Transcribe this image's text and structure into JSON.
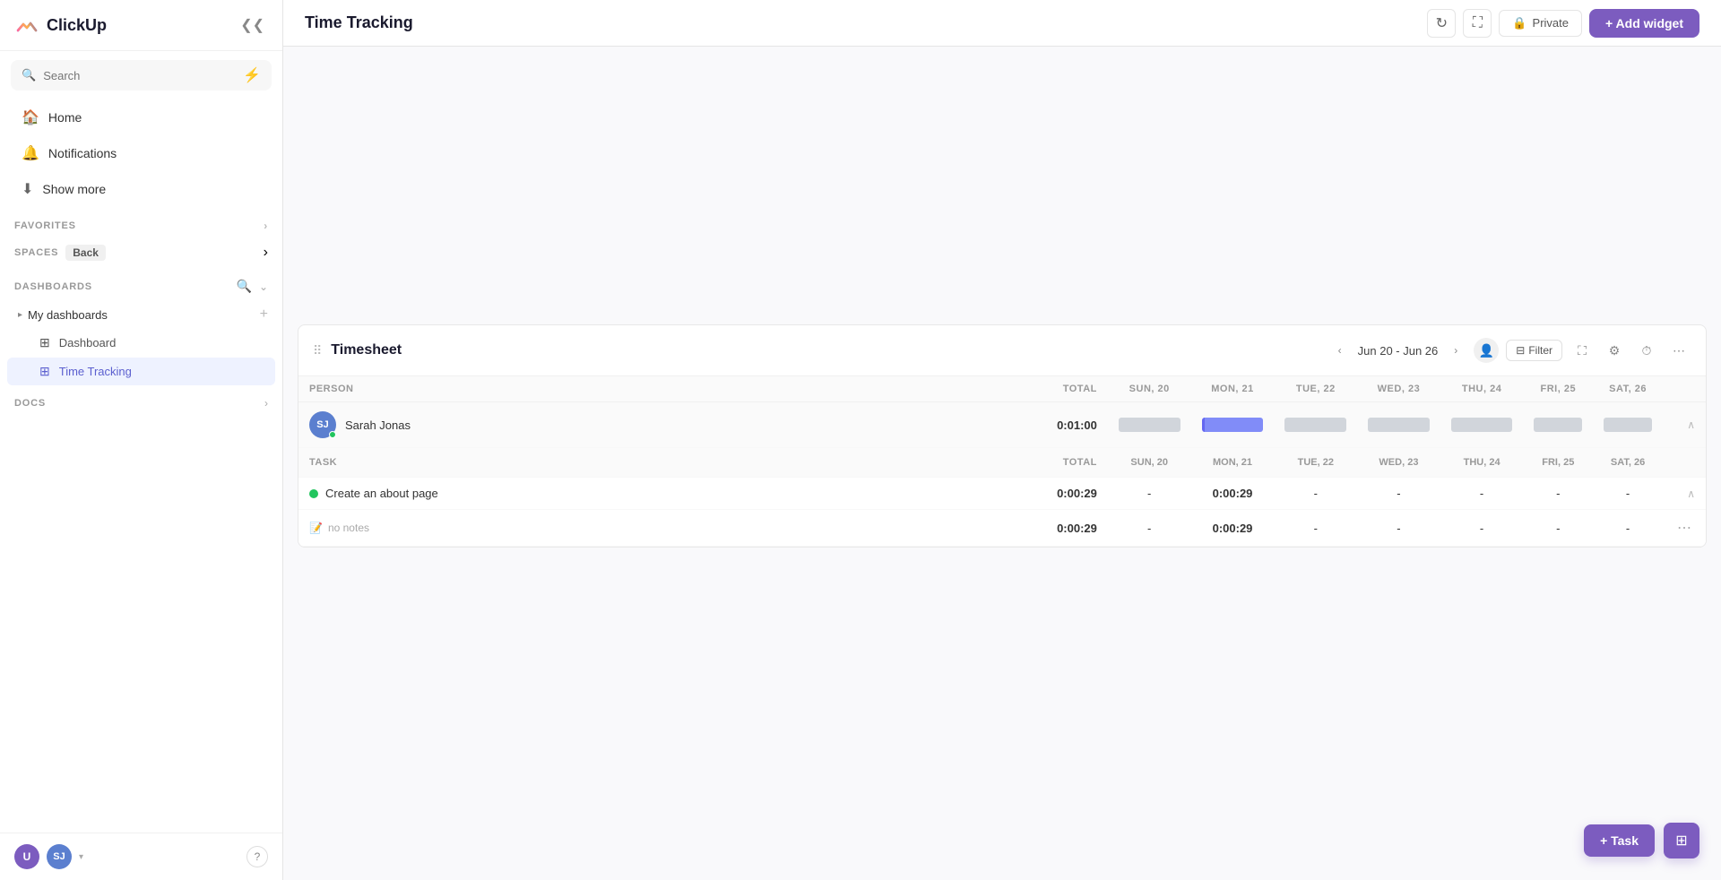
{
  "sidebar": {
    "logo_text": "ClickUp",
    "search_placeholder": "Search",
    "nav": [
      {
        "id": "home",
        "label": "Home",
        "icon": "🏠"
      },
      {
        "id": "notifications",
        "label": "Notifications",
        "icon": "🔔"
      },
      {
        "id": "show_more",
        "label": "Show more",
        "icon": "⬇"
      }
    ],
    "favorites_label": "FAVORITES",
    "spaces_label": "SPACES",
    "back_label": "Back",
    "dashboards_label": "DASHBOARDS",
    "my_dashboards_label": "My dashboards",
    "dash_items": [
      {
        "id": "dashboard",
        "label": "Dashboard",
        "icon": "⊞",
        "active": false
      },
      {
        "id": "time_tracking",
        "label": "Time Tracking",
        "icon": "⊞",
        "active": true
      }
    ],
    "docs_label": "DOCS",
    "avatar_u": "U",
    "avatar_sj": "SJ",
    "help": "?"
  },
  "topbar": {
    "title": "Time Tracking",
    "private_label": "Private",
    "add_widget_label": "+ Add widget"
  },
  "timesheet": {
    "title": "Timesheet",
    "date_range": "Jun 20 - Jun 26",
    "filter_label": "Filter",
    "columns": {
      "person_label": "PERSON",
      "task_label": "TASK",
      "total_label": "TOTAL",
      "days": [
        "SUN, 20",
        "MON, 21",
        "TUE, 22",
        "WED, 23",
        "THU, 24",
        "FRI, 25",
        "SAT, 26"
      ]
    },
    "person_row": {
      "name": "Sarah Jonas",
      "initials": "SJ",
      "total": "0:01:00",
      "sun": "",
      "mon": "",
      "tue": "",
      "wed": "",
      "thu": "",
      "fri": "",
      "sat": ""
    },
    "task_row": {
      "name": "Create an about page",
      "total": "0:00:29",
      "sun": "-",
      "mon": "0:00:29",
      "tue": "-",
      "wed": "-",
      "thu": "-",
      "fri": "-",
      "sat": "-"
    },
    "sub_row": {
      "label": "no notes",
      "total": "0:00:29",
      "sun": "-",
      "mon": "0:00:29",
      "tue": "-",
      "wed": "-",
      "thu": "-",
      "fri": "-",
      "sat": "-"
    }
  },
  "bottom": {
    "add_task_label": "+ Task"
  }
}
